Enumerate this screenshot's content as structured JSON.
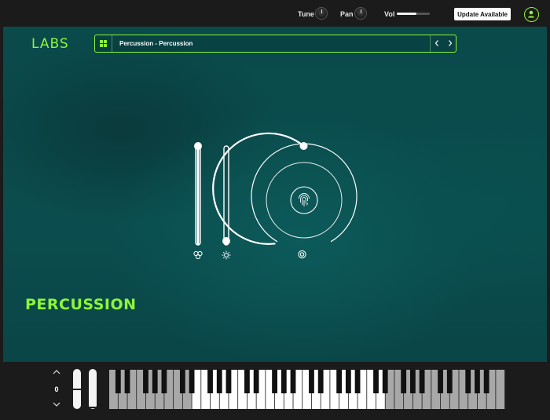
{
  "topbar": {
    "tune_label": "Tune",
    "pan_label": "Pan",
    "vol_label": "Vol",
    "vol_level": 0.6,
    "update_label": "Update Available",
    "user_icon": "user-icon"
  },
  "logo": "LABS",
  "preset": {
    "text": "Percussion  -  Percussion",
    "grid_icon": "grid-icon",
    "prev_icon": "chevron-left-icon",
    "next_icon": "chevron-right-icon"
  },
  "controls": {
    "slider1_level": 1.0,
    "slider1_icon": "circles-icon",
    "slider2_level": 0.0,
    "slider2_icon": "sun-icon",
    "knob_icon": "fingerprint-icon",
    "knob_button_icon": "target-icon"
  },
  "product_name": "PERCUSSION",
  "keyboard": {
    "octave_up_icon": "chevron-up-icon",
    "octave_value": "0",
    "octave_down_icon": "chevron-down-icon",
    "pitch_level": 0.5,
    "mod_level": 0.0,
    "white_key_count": 43,
    "active_start": 9,
    "active_end": 30,
    "colors": {
      "active_white": "#ffffff",
      "inactive_white": "#a8a8a8",
      "black": "#111111"
    }
  },
  "colors": {
    "accent": "#8df53a",
    "panel": "#0b4d4e",
    "background": "#1b1b1b"
  }
}
